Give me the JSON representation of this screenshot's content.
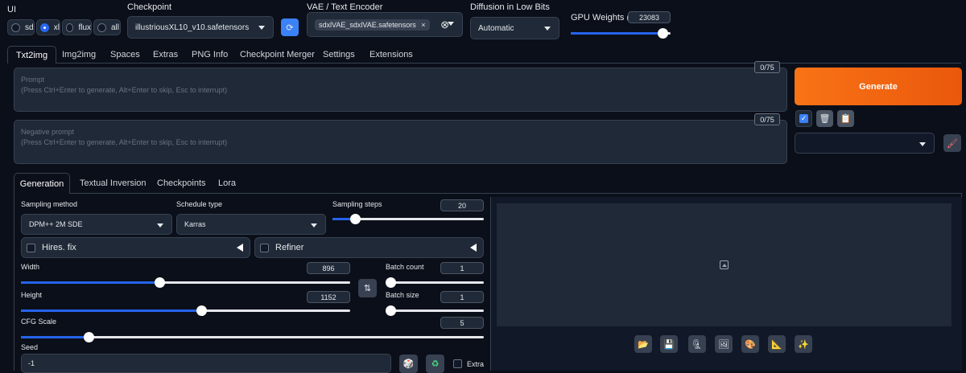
{
  "top": {
    "ui_label": "UI",
    "ui_options": [
      "sd",
      "xl",
      "flux",
      "all"
    ],
    "checkpoint_label": "Checkpoint",
    "checkpoint_value": "illustriousXL10_v10.safetensors",
    "vae_label": "VAE / Text Encoder",
    "vae_value": "sdxlVAE_sdxlVAE.safetensors",
    "diffusion_label": "Diffusion in Low Bits",
    "diffusion_value": "Automatic",
    "gpu_label": "GPU Weights (MB)",
    "gpu_value": "23083",
    "gpu_level": 0.95
  },
  "tabs": [
    "Txt2img",
    "Img2img",
    "Spaces",
    "Extras",
    "PNG Info",
    "Checkpoint Merger",
    "Settings",
    "Extensions"
  ],
  "prompt": {
    "label": "Prompt",
    "hint": "(Press Ctrl+Enter to generate, Alt+Enter to skip, Esc to interrupt)",
    "counter": "0/75"
  },
  "negative": {
    "label": "Negative prompt",
    "hint": "(Press Ctrl+Enter to generate, Alt+Enter to skip, Esc to interrupt)",
    "counter": "0/75"
  },
  "generate_label": "Generate",
  "subtabs": [
    "Generation",
    "Textual Inversion",
    "Checkpoints",
    "Lora"
  ],
  "gen": {
    "sampling_method_label": "Sampling method",
    "sampling_method": "DPM++ 2M SDE",
    "schedule_label": "Schedule type",
    "schedule": "Karras",
    "steps_label": "Sampling steps",
    "steps": "20",
    "hires_label": "Hires. fix",
    "refiner_label": "Refiner",
    "width_label": "Width",
    "width": "896",
    "height_label": "Height",
    "height": "1152",
    "batch_count_label": "Batch count",
    "batch_count": "1",
    "batch_size_label": "Batch size",
    "batch_size": "1",
    "cfg_label": "CFG Scale",
    "cfg": "5",
    "seed_label": "Seed",
    "seed": "-1",
    "extra_label": "Extra"
  },
  "colors": {
    "accent": "#2563eb",
    "generate": "#f97316",
    "bg": "#0b0f19"
  },
  "icons": [
    "refresh-icon",
    "swap-icon",
    "dice-icon",
    "recycle-icon",
    "folder-icon",
    "save-icon",
    "zip-icon",
    "image-icon",
    "palette-icon",
    "ruler-icon",
    "sparkle-icon",
    "brush-icon",
    "trash-icon",
    "clipboard-icon",
    "check-icon"
  ]
}
